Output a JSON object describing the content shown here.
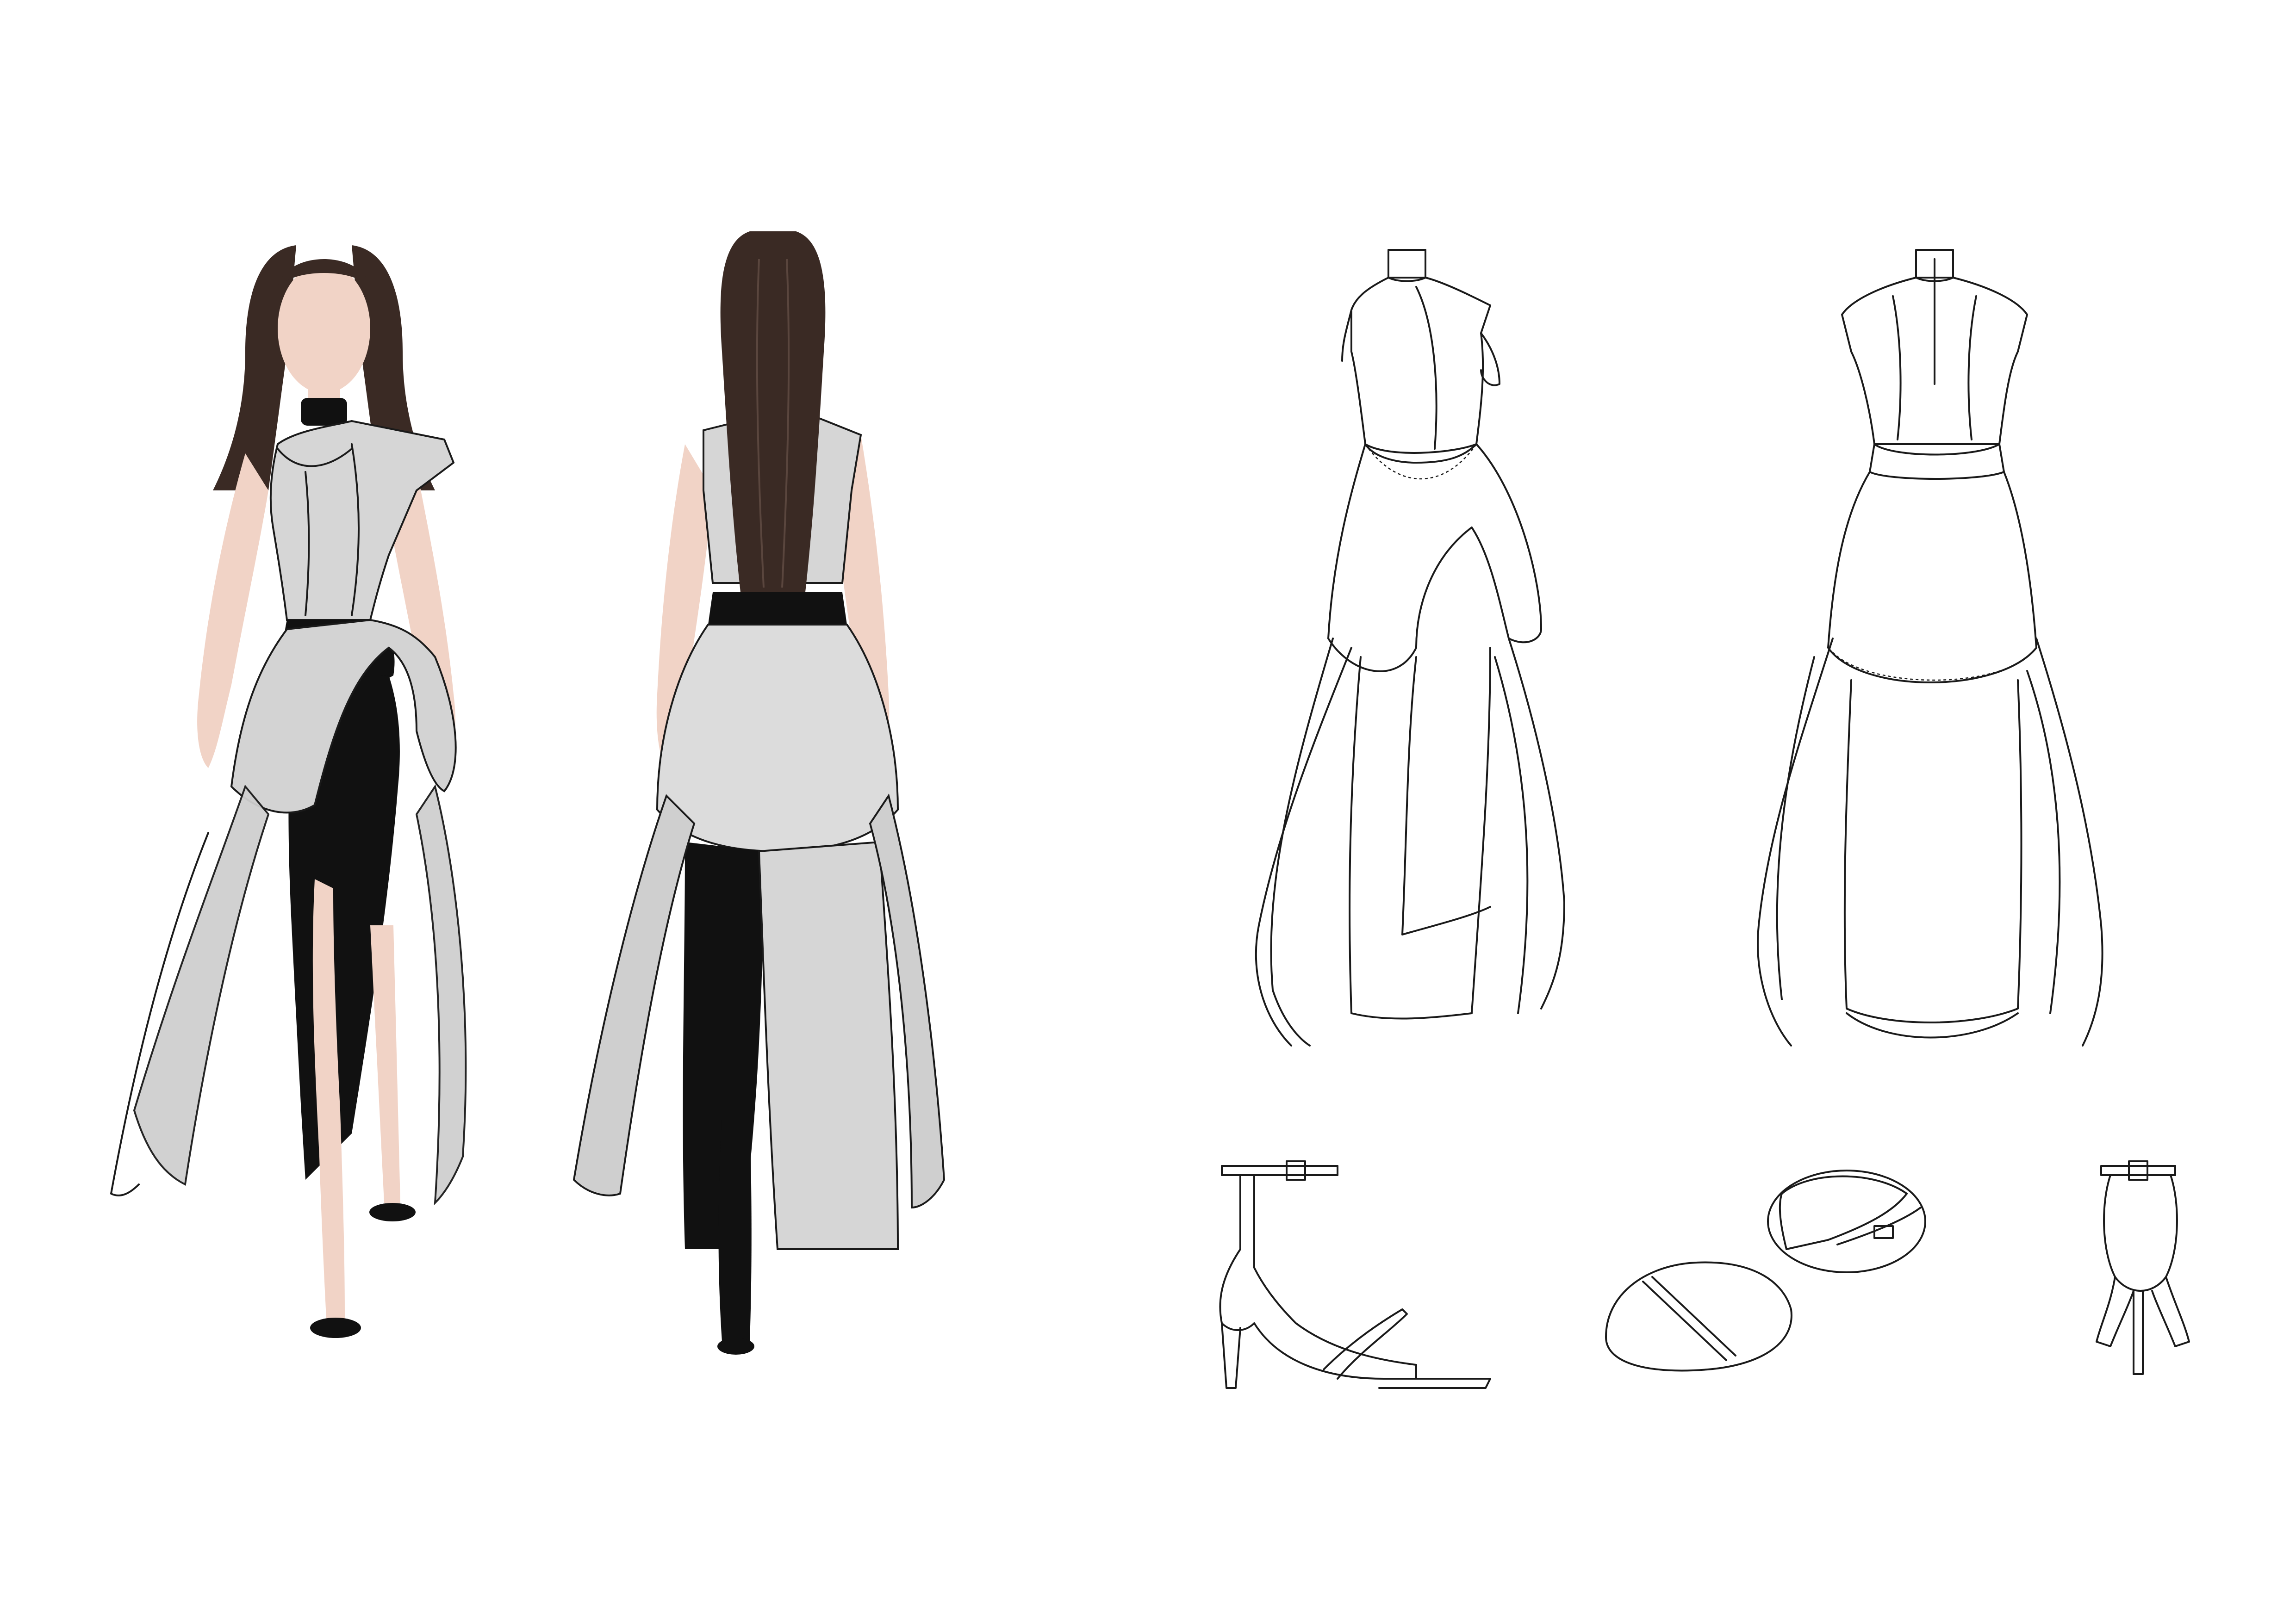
{
  "board": {
    "background": "#ffffff",
    "palette": {
      "silver": "#cfcfcf",
      "silver_light": "#ececec",
      "black_vinyl": "#111111",
      "skin": "#f1d3c6",
      "hair": "#3a2a24",
      "line": "#1a1a1a"
    }
  },
  "illustrations": [
    {
      "id": "front-figure",
      "icon": "fashion-figure-front"
    },
    {
      "id": "back-figure",
      "icon": "fashion-figure-back"
    }
  ],
  "flats": [
    {
      "id": "dress-front-flat",
      "icon": "dress-flat-front"
    },
    {
      "id": "dress-back-flat",
      "icon": "dress-flat-back"
    }
  ],
  "accessories": [
    {
      "id": "sandal-side",
      "icon": "stiletto-sandal-side"
    },
    {
      "id": "sandal-top",
      "icon": "stiletto-sandal-top"
    },
    {
      "id": "sandal-back",
      "icon": "stiletto-sandal-back"
    }
  ]
}
